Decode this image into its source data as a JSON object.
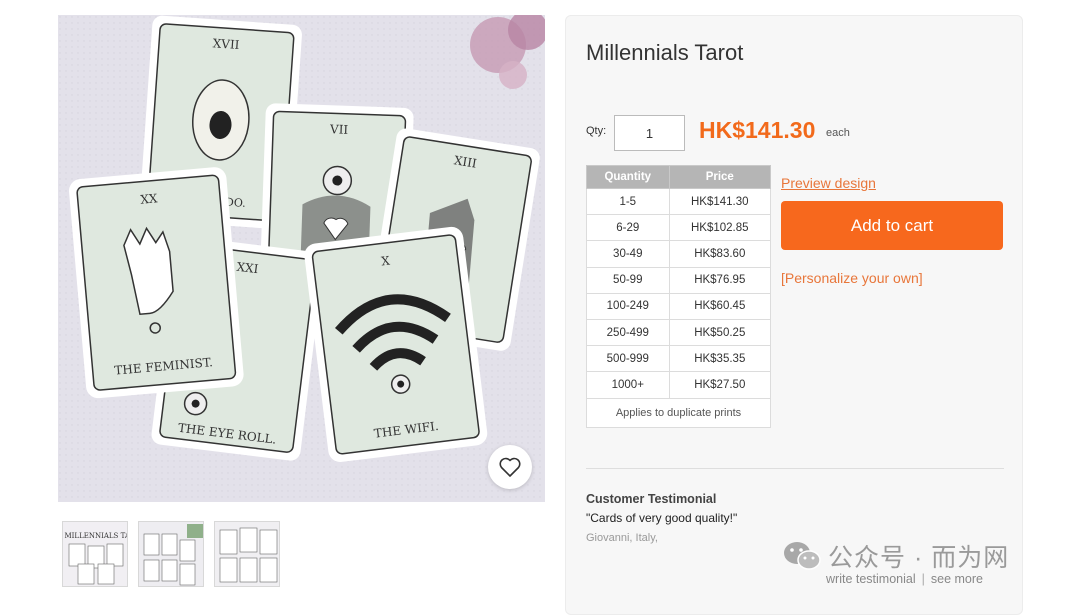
{
  "product": {
    "title": "Millennials Tarot",
    "images": {
      "main_alt": "Millennials Tarot card spread",
      "card_labels": [
        "THE FEMINIST.",
        "THE EYE ROLL.",
        "THE WIFI.",
        "AVOCADO."
      ],
      "card_numerals": [
        "XX",
        "XXI",
        "X",
        "XVII",
        "VII",
        "XIII"
      ],
      "thumbnail_title": "THE MILLENNIALS TAROT"
    }
  },
  "purchase": {
    "qty_label": "Qty:",
    "qty_value": "1",
    "price": "HK$141.30",
    "price_suffix": "each",
    "preview_label": "Preview design",
    "add_to_cart_label": "Add to cart",
    "personalize_label": "[Personalize your own]"
  },
  "pricing_table": {
    "headers": [
      "Quantity",
      "Price"
    ],
    "rows": [
      [
        "1-5",
        "HK$141.30"
      ],
      [
        "6-29",
        "HK$102.85"
      ],
      [
        "30-49",
        "HK$83.60"
      ],
      [
        "50-99",
        "HK$76.95"
      ],
      [
        "100-249",
        "HK$60.45"
      ],
      [
        "250-499",
        "HK$50.25"
      ],
      [
        "500-999",
        "HK$35.35"
      ],
      [
        "1000+",
        "HK$27.50"
      ]
    ],
    "footnote": "Applies to duplicate prints"
  },
  "testimonial": {
    "heading": "Customer Testimonial",
    "quote": "\"Cards of very good quality!\"",
    "author": "Giovanni, Italy,"
  },
  "footer_links": {
    "write": "write testimonial",
    "separator": "|",
    "see_more": "see more"
  },
  "watermark": {
    "text": "公众号 · 而为网"
  },
  "icons": {
    "wishlist": "heart-icon",
    "watermark_logo": "wechat-icon"
  },
  "colors": {
    "accent": "#f7681d",
    "price": "#f26a1b",
    "link": "#e8763a",
    "table_header": "#b5b5b5"
  }
}
